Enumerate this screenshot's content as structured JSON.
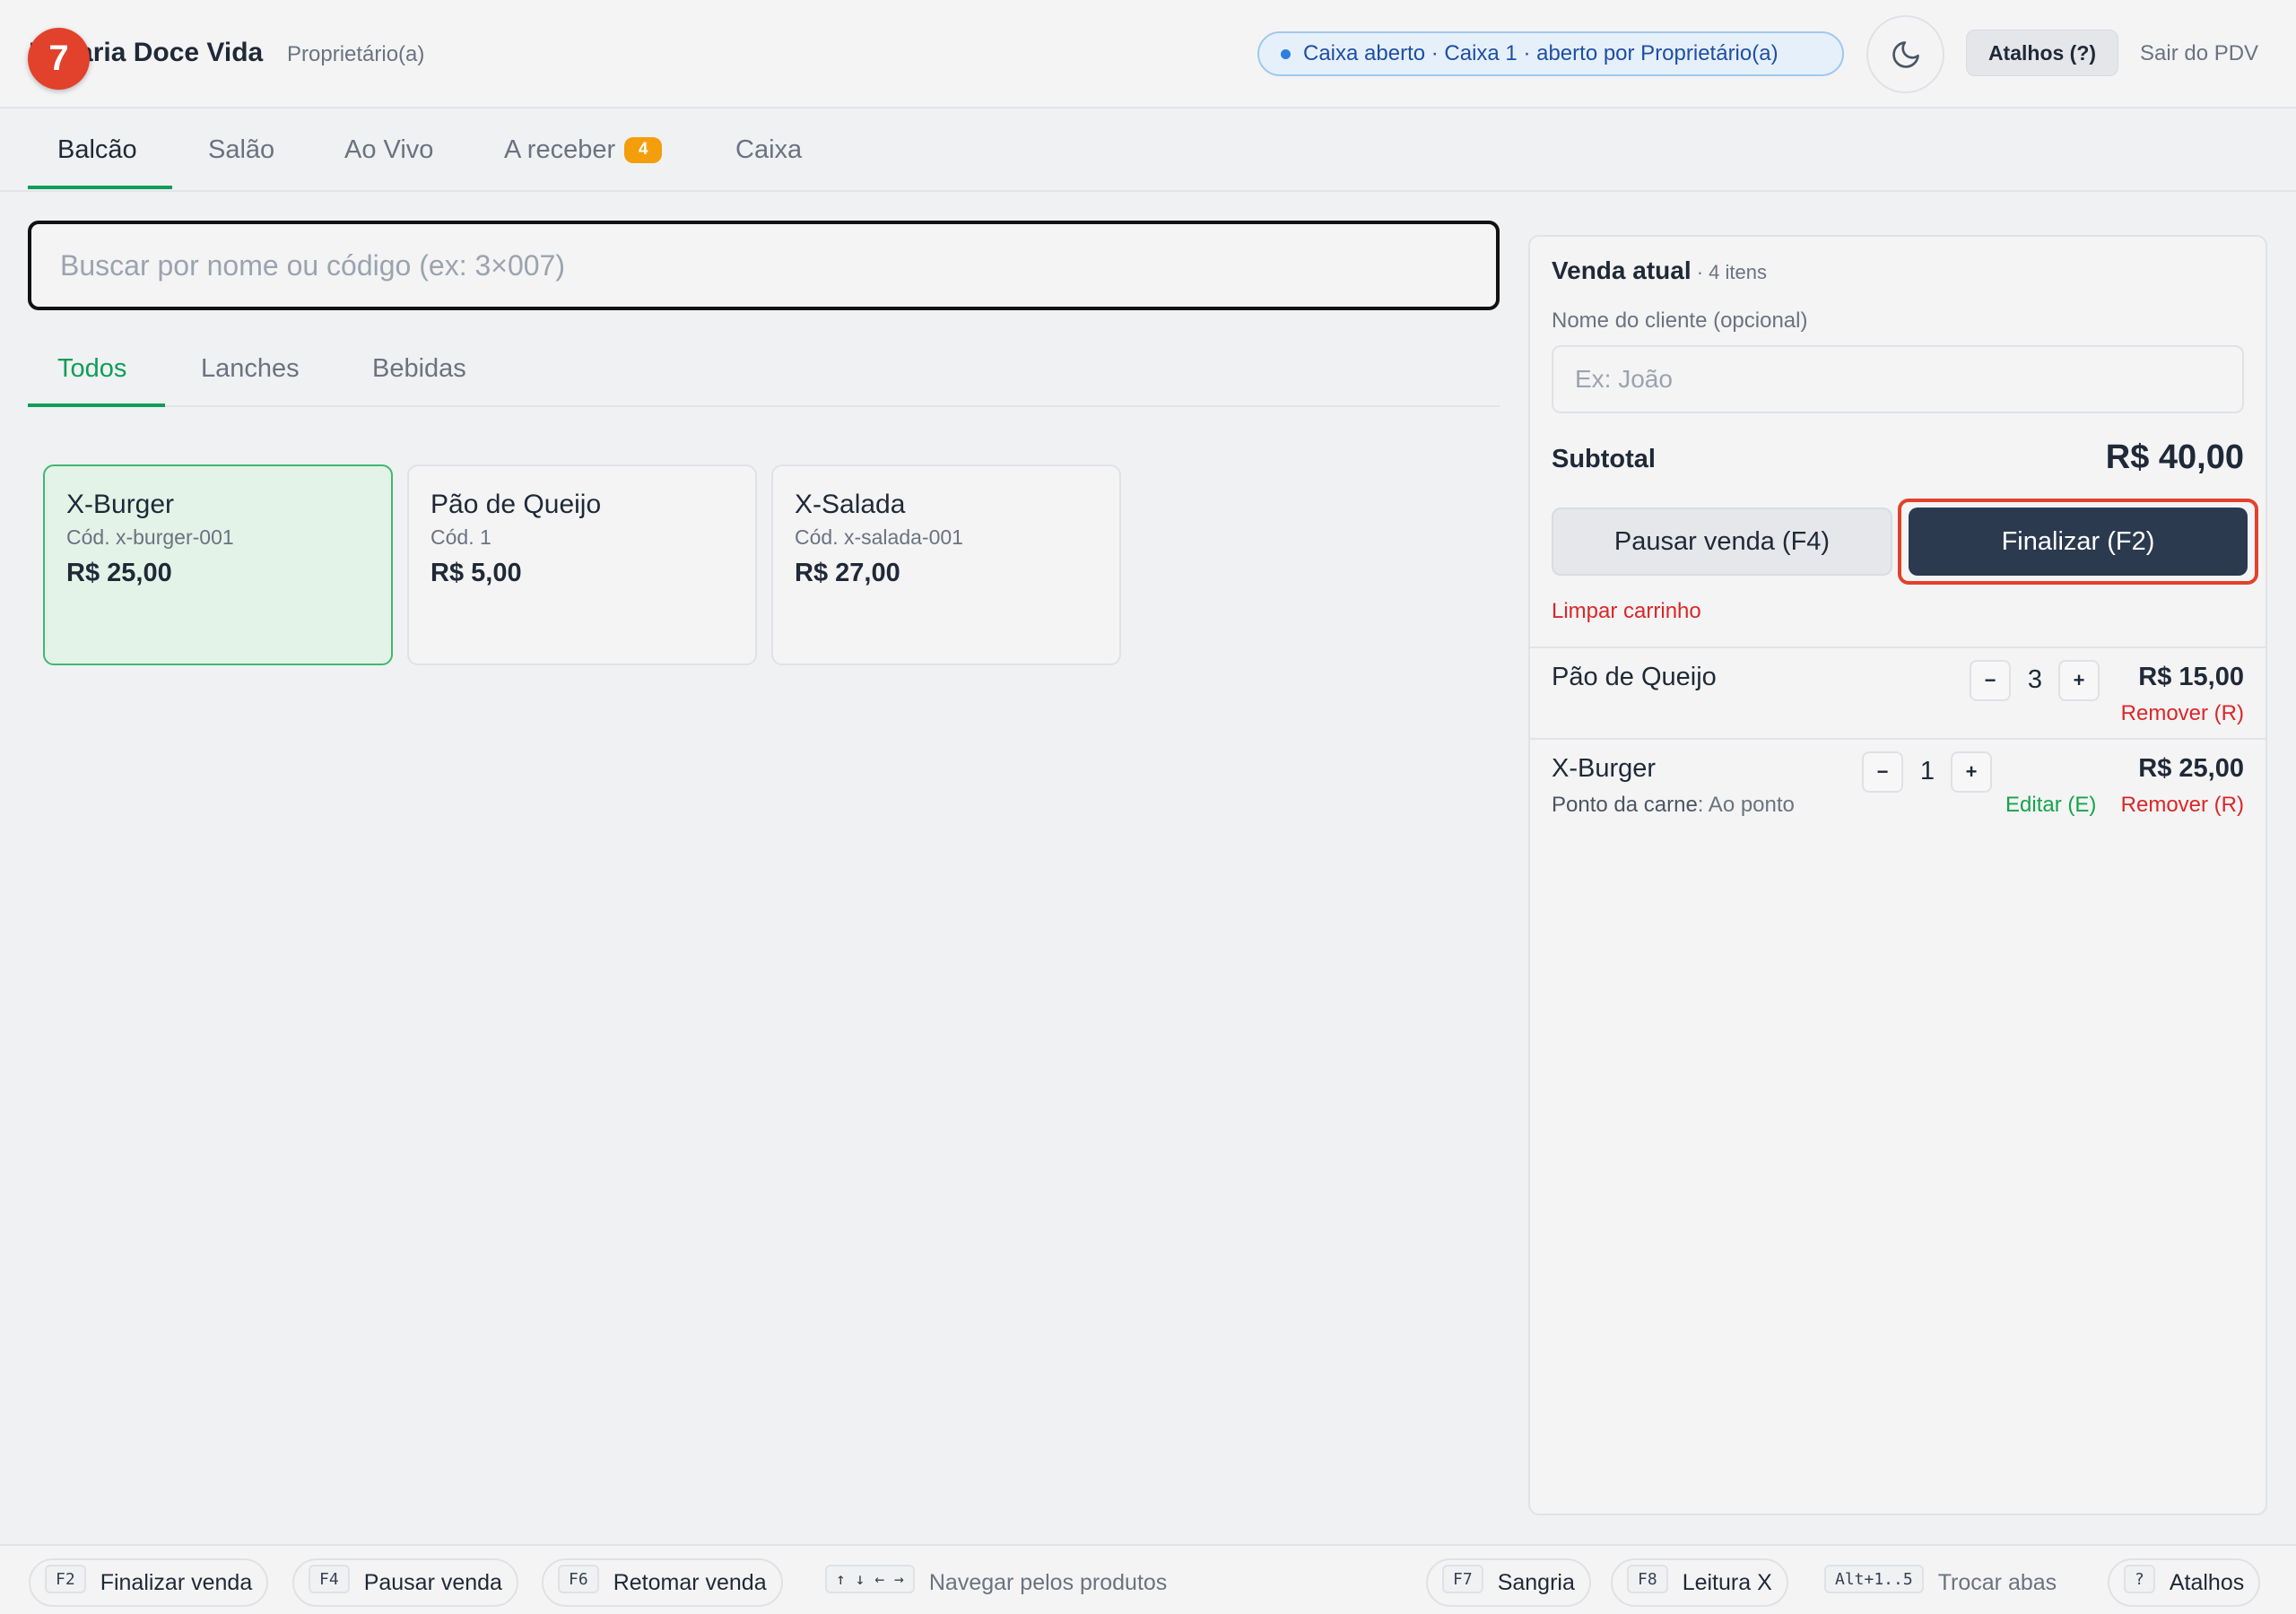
{
  "header": {
    "step_badge": "7",
    "store_name": "Padaria Doce Vida",
    "role": "Proprietário(a)",
    "cash_status": "Caixa aberto · Caixa 1 · aberto por Proprietário(a)",
    "shortcuts_label": "Atalhos (?)",
    "exit_label": "Sair do PDV"
  },
  "main_tabs": [
    {
      "label": "Balcão"
    },
    {
      "label": "Salão"
    },
    {
      "label": "Ao Vivo"
    },
    {
      "label": "A receber",
      "badge": "4"
    },
    {
      "label": "Caixa"
    }
  ],
  "search": {
    "placeholder": "Buscar por nome ou código (ex: 3×007)",
    "value": ""
  },
  "category_tabs": [
    {
      "label": "Todos"
    },
    {
      "label": "Lanches"
    },
    {
      "label": "Bebidas"
    }
  ],
  "products": [
    {
      "name": "X-Burger",
      "code": "Cód. x-burger-001",
      "price": "R$ 25,00"
    },
    {
      "name": "Pão de Queijo",
      "code": "Cód. 1",
      "price": "R$ 5,00"
    },
    {
      "name": "X-Salada",
      "code": "Cód. x-salada-001",
      "price": "R$ 27,00"
    }
  ],
  "cart": {
    "title": "Venda atual",
    "count": " · 4 itens",
    "client_label": "Nome do cliente (opcional)",
    "client_placeholder": "Ex: João",
    "client_value": "",
    "subtotal_label": "Subtotal",
    "subtotal_value": "R$ 40,00",
    "pause_label": "Pausar venda (F4)",
    "finalize_label": "Finalizar (F2)",
    "clear_label": "Limpar carrinho",
    "items": [
      {
        "name": "Pão de Queijo",
        "qty": "3",
        "total": "R$ 15,00",
        "remove": "Remover (R)"
      },
      {
        "name": "X-Burger",
        "detail_key": "Ponto da carne",
        "detail_value": ": Ao ponto",
        "qty": "1",
        "total": "R$ 25,00",
        "edit": "Editar (E)",
        "remove": "Remover (R)"
      }
    ],
    "minus": "−",
    "plus": "+"
  },
  "footer": {
    "hints": [
      {
        "key": "F2",
        "label": "Finalizar venda"
      },
      {
        "key": "F4",
        "label": "Pausar venda"
      },
      {
        "key": "F6",
        "label": "Retomar venda"
      },
      {
        "key": "↑ ↓ ← →",
        "label": "Navegar pelos produtos"
      },
      {
        "key": "F7",
        "label": "Sangria"
      },
      {
        "key": "F8",
        "label": "Leitura X"
      },
      {
        "key": "Alt+1..5",
        "label": "Trocar abas"
      },
      {
        "key": "?",
        "label": "Atalhos"
      }
    ]
  },
  "colors": {
    "accent_green": "#0f9d58",
    "danger_red": "#dc2626",
    "primary_dark": "#2b3a4f",
    "highlight_red": "#e2412b",
    "badge_orange": "#f59e0b"
  },
  "icons": {
    "theme": "moon-icon",
    "status": "dot-icon"
  }
}
